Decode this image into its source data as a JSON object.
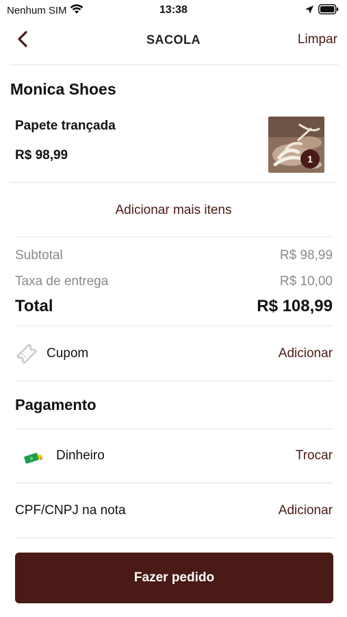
{
  "status_bar": {
    "carrier": "Nenhum SIM",
    "time": "13:38"
  },
  "nav": {
    "title": "SACOLA",
    "clear_label": "Limpar"
  },
  "store": {
    "name": "Monica Shoes"
  },
  "cart_item": {
    "name": "Papete trançada",
    "price": "R$ 98,99",
    "quantity": "1"
  },
  "add_more_label": "Adicionar mais itens",
  "summary": {
    "subtotal_label": "Subtotal",
    "subtotal_value": "R$ 98,99",
    "delivery_label": "Taxa de entrega",
    "delivery_value": "R$ 10,00",
    "total_label": "Total",
    "total_value": "R$ 108,99"
  },
  "coupon": {
    "label": "Cupom",
    "action": "Adicionar"
  },
  "payment": {
    "section_title": "Pagamento",
    "method": "Dinheiro",
    "action": "Trocar"
  },
  "cpf": {
    "label": "CPF/CNPJ na nota",
    "action": "Adicionar"
  },
  "order_button_label": "Fazer pedido",
  "colors": {
    "accent": "#4a1a16",
    "muted_text": "#8a8a8a",
    "divider": "#e3e3e3",
    "cash_green": "#1f9d4a"
  },
  "icons": [
    "wifi-icon",
    "location-arrow-icon",
    "battery-icon",
    "back-chevron-icon",
    "coupon-icon",
    "cash-icon"
  ]
}
